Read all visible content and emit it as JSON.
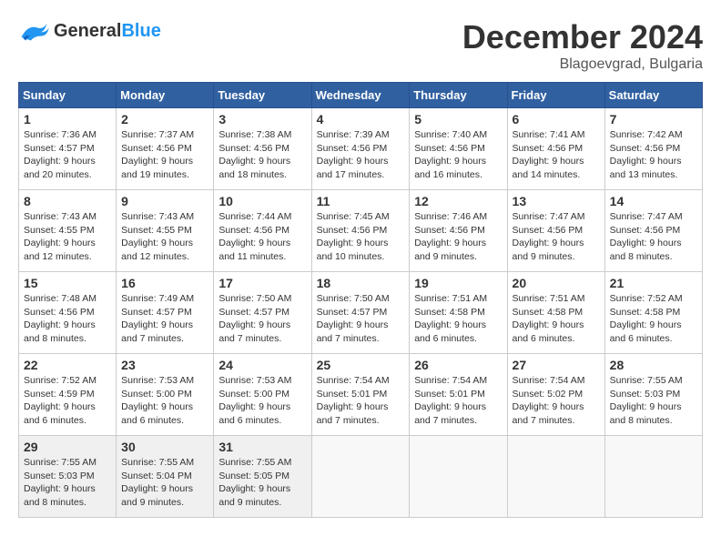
{
  "header": {
    "logo_general": "General",
    "logo_blue": "Blue",
    "month": "December 2024",
    "location": "Blagoevgrad, Bulgaria"
  },
  "weekdays": [
    "Sunday",
    "Monday",
    "Tuesday",
    "Wednesday",
    "Thursday",
    "Friday",
    "Saturday"
  ],
  "weeks": [
    [
      {
        "day": "1",
        "sunrise": "7:36 AM",
        "sunset": "4:57 PM",
        "daylight": "9 hours and 20 minutes."
      },
      {
        "day": "2",
        "sunrise": "7:37 AM",
        "sunset": "4:56 PM",
        "daylight": "9 hours and 19 minutes."
      },
      {
        "day": "3",
        "sunrise": "7:38 AM",
        "sunset": "4:56 PM",
        "daylight": "9 hours and 18 minutes."
      },
      {
        "day": "4",
        "sunrise": "7:39 AM",
        "sunset": "4:56 PM",
        "daylight": "9 hours and 17 minutes."
      },
      {
        "day": "5",
        "sunrise": "7:40 AM",
        "sunset": "4:56 PM",
        "daylight": "9 hours and 16 minutes."
      },
      {
        "day": "6",
        "sunrise": "7:41 AM",
        "sunset": "4:56 PM",
        "daylight": "9 hours and 14 minutes."
      },
      {
        "day": "7",
        "sunrise": "7:42 AM",
        "sunset": "4:56 PM",
        "daylight": "9 hours and 13 minutes."
      }
    ],
    [
      {
        "day": "8",
        "sunrise": "7:43 AM",
        "sunset": "4:55 PM",
        "daylight": "9 hours and 12 minutes."
      },
      {
        "day": "9",
        "sunrise": "7:43 AM",
        "sunset": "4:55 PM",
        "daylight": "9 hours and 12 minutes."
      },
      {
        "day": "10",
        "sunrise": "7:44 AM",
        "sunset": "4:56 PM",
        "daylight": "9 hours and 11 minutes."
      },
      {
        "day": "11",
        "sunrise": "7:45 AM",
        "sunset": "4:56 PM",
        "daylight": "9 hours and 10 minutes."
      },
      {
        "day": "12",
        "sunrise": "7:46 AM",
        "sunset": "4:56 PM",
        "daylight": "9 hours and 9 minutes."
      },
      {
        "day": "13",
        "sunrise": "7:47 AM",
        "sunset": "4:56 PM",
        "daylight": "9 hours and 9 minutes."
      },
      {
        "day": "14",
        "sunrise": "7:47 AM",
        "sunset": "4:56 PM",
        "daylight": "9 hours and 8 minutes."
      }
    ],
    [
      {
        "day": "15",
        "sunrise": "7:48 AM",
        "sunset": "4:56 PM",
        "daylight": "9 hours and 8 minutes."
      },
      {
        "day": "16",
        "sunrise": "7:49 AM",
        "sunset": "4:57 PM",
        "daylight": "9 hours and 7 minutes."
      },
      {
        "day": "17",
        "sunrise": "7:50 AM",
        "sunset": "4:57 PM",
        "daylight": "9 hours and 7 minutes."
      },
      {
        "day": "18",
        "sunrise": "7:50 AM",
        "sunset": "4:57 PM",
        "daylight": "9 hours and 7 minutes."
      },
      {
        "day": "19",
        "sunrise": "7:51 AM",
        "sunset": "4:58 PM",
        "daylight": "9 hours and 6 minutes."
      },
      {
        "day": "20",
        "sunrise": "7:51 AM",
        "sunset": "4:58 PM",
        "daylight": "9 hours and 6 minutes."
      },
      {
        "day": "21",
        "sunrise": "7:52 AM",
        "sunset": "4:58 PM",
        "daylight": "9 hours and 6 minutes."
      }
    ],
    [
      {
        "day": "22",
        "sunrise": "7:52 AM",
        "sunset": "4:59 PM",
        "daylight": "9 hours and 6 minutes."
      },
      {
        "day": "23",
        "sunrise": "7:53 AM",
        "sunset": "5:00 PM",
        "daylight": "9 hours and 6 minutes."
      },
      {
        "day": "24",
        "sunrise": "7:53 AM",
        "sunset": "5:00 PM",
        "daylight": "9 hours and 6 minutes."
      },
      {
        "day": "25",
        "sunrise": "7:54 AM",
        "sunset": "5:01 PM",
        "daylight": "9 hours and 7 minutes."
      },
      {
        "day": "26",
        "sunrise": "7:54 AM",
        "sunset": "5:01 PM",
        "daylight": "9 hours and 7 minutes."
      },
      {
        "day": "27",
        "sunrise": "7:54 AM",
        "sunset": "5:02 PM",
        "daylight": "9 hours and 7 minutes."
      },
      {
        "day": "28",
        "sunrise": "7:55 AM",
        "sunset": "5:03 PM",
        "daylight": "9 hours and 8 minutes."
      }
    ],
    [
      {
        "day": "29",
        "sunrise": "7:55 AM",
        "sunset": "5:03 PM",
        "daylight": "9 hours and 8 minutes."
      },
      {
        "day": "30",
        "sunrise": "7:55 AM",
        "sunset": "5:04 PM",
        "daylight": "9 hours and 9 minutes."
      },
      {
        "day": "31",
        "sunrise": "7:55 AM",
        "sunset": "5:05 PM",
        "daylight": "9 hours and 9 minutes."
      },
      null,
      null,
      null,
      null
    ]
  ]
}
